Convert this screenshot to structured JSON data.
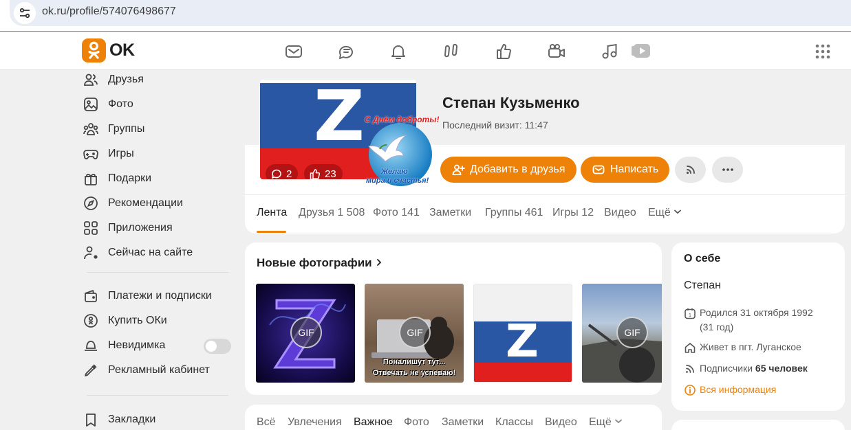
{
  "browser": {
    "url": "ok.ru/profile/574076498677"
  },
  "header": {
    "logo_text": "OK",
    "nav_icons": [
      "mail-icon",
      "discussions-icon",
      "notifications-icon",
      "guests-icon",
      "likes-icon",
      "video-calls-icon",
      "music-icon",
      "video-icon"
    ],
    "apps_icon": "apps-grid-icon",
    "accent": "#ee8208"
  },
  "sidebar": {
    "items": [
      {
        "label": "Друзья",
        "icon": "friends-icon"
      },
      {
        "label": "Фото",
        "icon": "photo-icon"
      },
      {
        "label": "Группы",
        "icon": "groups-icon"
      },
      {
        "label": "Игры",
        "icon": "gamepad-icon"
      },
      {
        "label": "Подарки",
        "icon": "gift-icon"
      },
      {
        "label": "Рекомендации",
        "icon": "compass-icon"
      },
      {
        "label": "Приложения",
        "icon": "apps-icon"
      },
      {
        "label": "Сейчас на сайте",
        "icon": "online-user-icon"
      }
    ],
    "items2": [
      {
        "label": "Платежи и подписки",
        "icon": "wallet-icon"
      },
      {
        "label": "Купить ОКи",
        "icon": "coin-icon"
      },
      {
        "label": "Невидимка",
        "icon": "invisible-hat-icon",
        "toggle": false
      },
      {
        "label": "Рекламный кабинет",
        "icon": "ad-cabinet-icon"
      }
    ],
    "items3": [
      {
        "label": "Закладки",
        "icon": "bookmark-icon"
      }
    ]
  },
  "profile": {
    "name": "Степан Кузьменко",
    "last_visit": "Последний визит: 11:47",
    "avatar_letter": "Z",
    "comments_count": "2",
    "likes_count": "23",
    "sticker_line1": "С Днём доброты!",
    "sticker_line2": "Желаю",
    "sticker_line3": "мира и счастья!",
    "add_friend_label": "Добавить в друзья",
    "message_label": "Написать",
    "tabs": [
      {
        "label": "Лента"
      },
      {
        "label": "Друзья 1 508"
      },
      {
        "label": "Фото 141"
      },
      {
        "label": "Заметки"
      },
      {
        "label": "Группы 461"
      },
      {
        "label": "Игры 12"
      },
      {
        "label": "Видео"
      },
      {
        "label": "Ещё"
      }
    ]
  },
  "photos": {
    "title": "Новые фотографии",
    "gif_label": "GIF",
    "thumb2_caption1": "Поналишут тут...",
    "thumb2_caption2": "Отвечать не успеваю!",
    "thumb3_letter": "Z"
  },
  "about": {
    "title": "О себе",
    "name": "Степан",
    "born_line1": "Родился 31 октября 1992",
    "born_line2": "(31 год)",
    "lives": "Живет в пгт. Луганское",
    "subscribers_prefix": "Подписчики",
    "subscribers_count": "65 человек",
    "all_info": "Вся информация"
  },
  "feed": {
    "filters": [
      {
        "label": "Всё"
      },
      {
        "label": "Увлечения"
      },
      {
        "label": "Важное"
      },
      {
        "label": "Фото"
      },
      {
        "label": "Заметки"
      },
      {
        "label": "Классы"
      },
      {
        "label": "Видео"
      },
      {
        "label": "Ещё"
      }
    ]
  }
}
